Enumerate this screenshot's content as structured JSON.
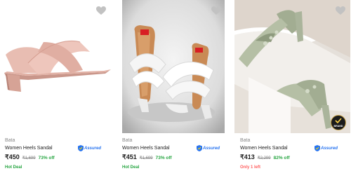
{
  "products": [
    {
      "brand": "Bata",
      "title": "Women Heels Sandal",
      "assured_label": "Assured",
      "price": "₹450",
      "mrp": "₹1,699",
      "discount": "73% off",
      "tag": "Hot Deal",
      "tag_color": "#26a541",
      "image_desc": "pink-cross-strap-block-heel-sandal"
    },
    {
      "brand": "Bata",
      "title": "Women Heels Sandal",
      "assured_label": "Assured",
      "price": "₹451",
      "mrp": "₹1,699",
      "discount": "73% off",
      "tag": "Hot Deal",
      "tag_color": "#26a541",
      "image_desc": "white-cross-strap-heel-sandal-pair"
    },
    {
      "brand": "Bata",
      "title": "Women Heels Sandal",
      "assured_label": "Assured",
      "price": "₹413",
      "mrp": "₹2,299",
      "discount": "82% off",
      "tag": "Only 1 left",
      "tag_color": "#ff6161",
      "image_desc": "sage-green-embroidered-thong-heel-sandal"
    }
  ],
  "colors": {
    "assured_blue": "#2874f0",
    "discount_green": "#26a541",
    "muted_text": "#878787"
  },
  "icons": {
    "wishlist": "heart-icon",
    "assured": "assured-shield-icon",
    "badge": "brand-badge-icon"
  },
  "badge_text": "BRAND"
}
